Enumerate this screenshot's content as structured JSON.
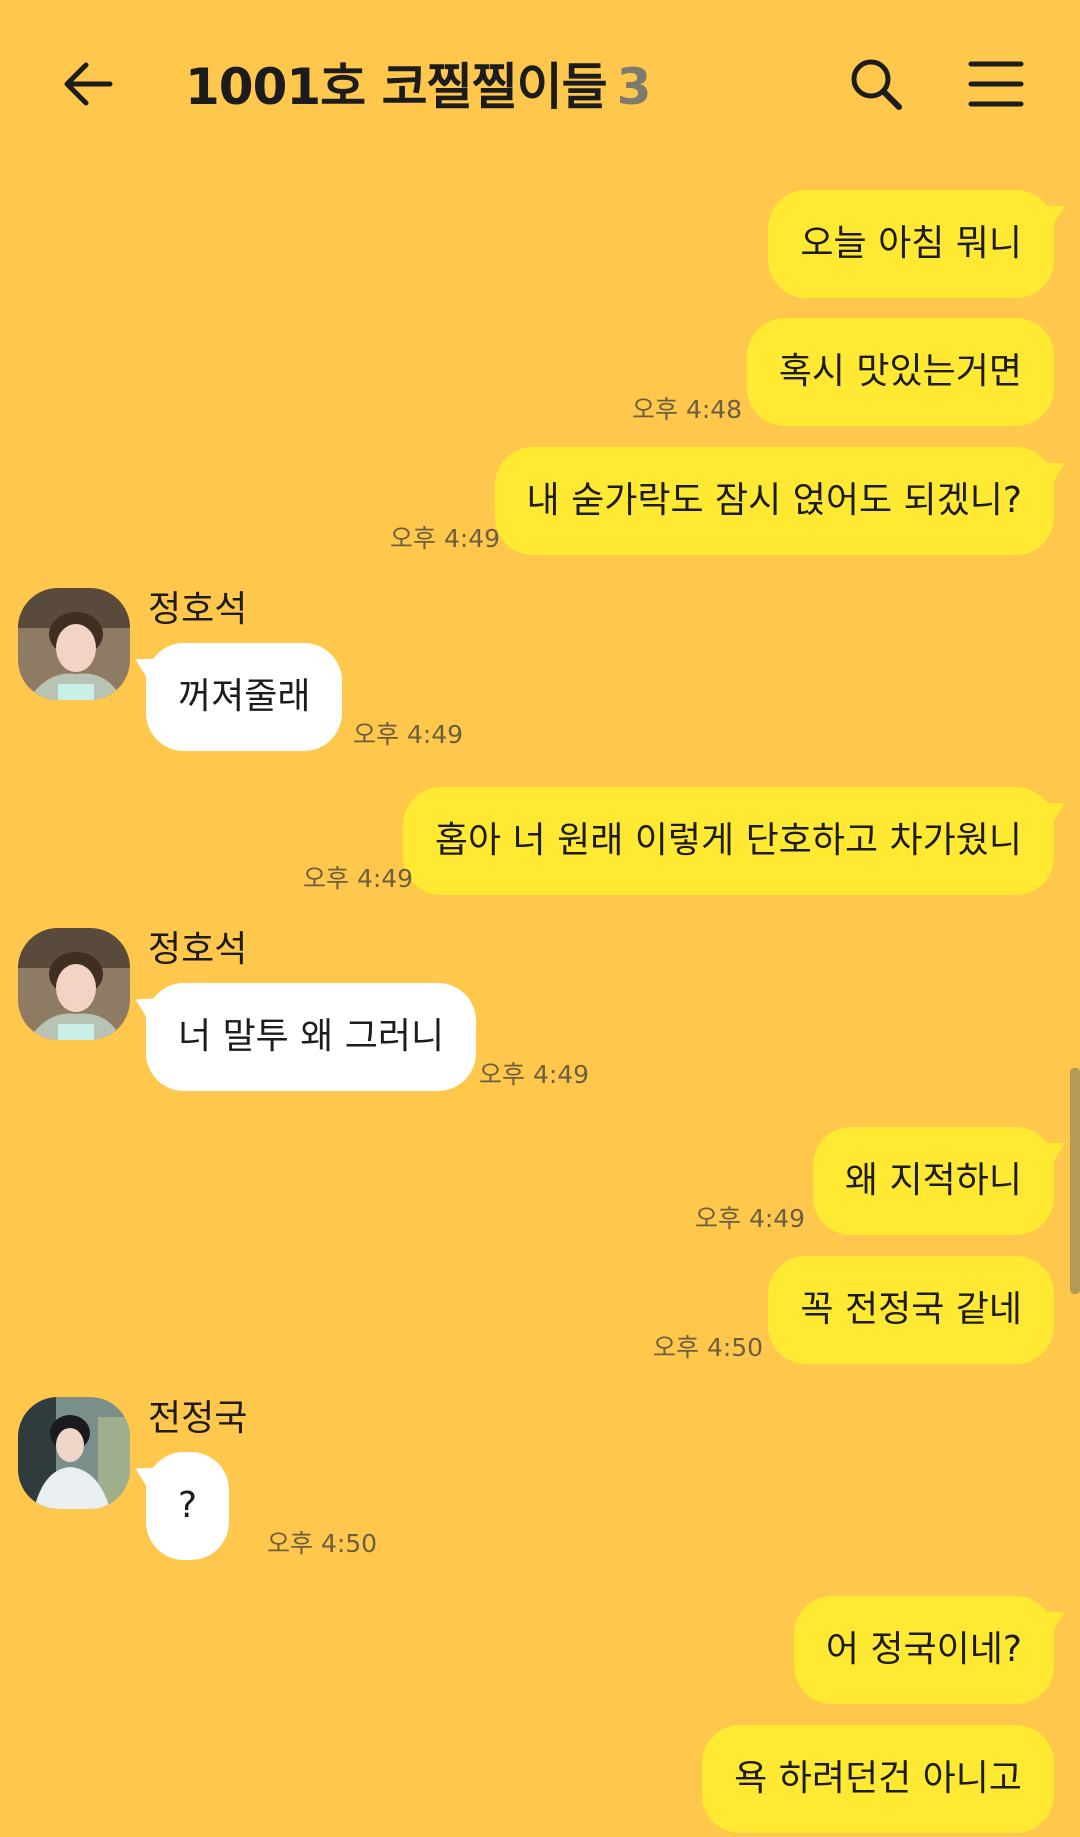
{
  "header": {
    "back_icon": "arrow-left-icon",
    "title": "1001호 코찔찔이들",
    "member_count": "3",
    "search_icon": "search-icon",
    "menu_icon": "hamburger-menu-icon"
  },
  "colors": {
    "background": "#FFC84C",
    "outgoing_bubble": "#FFE933",
    "incoming_bubble": "#FFFFFF"
  },
  "messages": [
    {
      "direction": "outgoing",
      "text": "오늘 아침 뭐니",
      "time": ""
    },
    {
      "direction": "outgoing",
      "text": "혹시 맛있는거면",
      "time": "오후 4:48"
    },
    {
      "direction": "outgoing",
      "text": "내 숟가락도 잠시 얹어도 되겠니?",
      "time": "오후 4:49"
    },
    {
      "direction": "incoming",
      "sender": "정호석",
      "text": "꺼져줄래",
      "time": "오후 4:49"
    },
    {
      "direction": "outgoing",
      "text": "홉아 너 원래 이렇게 단호하고 차가웠니",
      "time": "오후 4:49"
    },
    {
      "direction": "incoming",
      "sender": "정호석",
      "text": "너 말투 왜 그러니",
      "time": "오후 4:49"
    },
    {
      "direction": "outgoing",
      "text": "왜 지적하니",
      "time": "오후 4:49"
    },
    {
      "direction": "outgoing",
      "text": "꼭 전정국 같네",
      "time": "오후 4:50"
    },
    {
      "direction": "incoming",
      "sender": "전정국",
      "text": "?",
      "time": "오후 4:50"
    },
    {
      "direction": "outgoing",
      "text": "어 정국이네?",
      "time": ""
    },
    {
      "direction": "outgoing",
      "text": "욕 하려던건 아니고",
      "time": ""
    }
  ]
}
